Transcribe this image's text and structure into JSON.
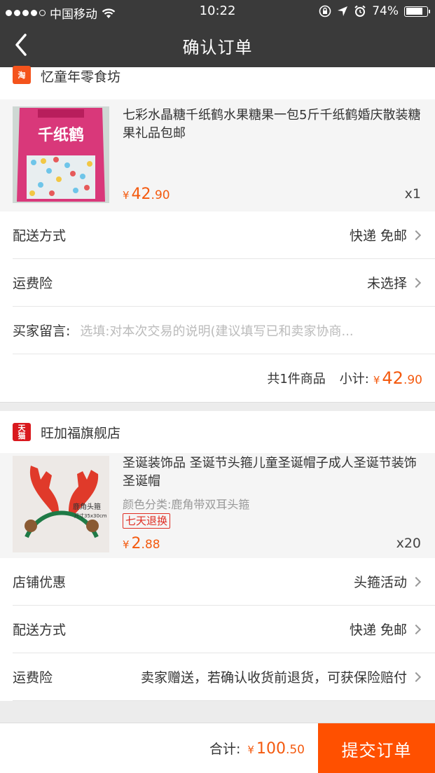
{
  "status_bar": {
    "carrier": "中国移动",
    "time": "10:22",
    "battery": "74%"
  },
  "nav": {
    "title": "确认订单"
  },
  "shops": [
    {
      "name": "忆童年零食坊",
      "logo_text": "淘",
      "product": {
        "title": "七彩水晶糖千纸鹤水果糖果一包5斤千纸鹤婚庆散装糖果礼品包邮",
        "image_text": "千纸鹤",
        "price_int": "42",
        "price_dec": ".90",
        "qty": "x1"
      },
      "delivery_label": "配送方式",
      "delivery_value": "快递 免邮",
      "insurance_label": "运费险",
      "insurance_value": "未选择",
      "message_label": "买家留言:",
      "message_placeholder": "选填:对本次交易的说明(建议填写已和卖家协商...",
      "count_text": "共1件商品",
      "subtotal_label": "小计:",
      "subtotal_int": "42",
      "subtotal_dec": ".90"
    },
    {
      "name": "旺加福旗舰店",
      "logo_line1": "天",
      "logo_line2": "猫",
      "product": {
        "title": "圣诞装饰品  圣诞节头箍儿童圣诞帽子成人圣诞节装饰 圣诞帽",
        "sku": "颜色分类:鹿角带双耳头箍",
        "tag": "七天退换",
        "image_text": "鹿角头箍",
        "image_subtext": "尺寸35x30cm",
        "price_int": "2",
        "price_dec": ".88",
        "qty": "x20"
      },
      "promo_label": "店铺优惠",
      "promo_value": "头箍活动",
      "delivery_label": "配送方式",
      "delivery_value": "快递 免邮",
      "insurance_label": "运费险",
      "insurance_value": "卖家赠送，若确认收货前退货，可获保险赔付"
    }
  ],
  "currency": "¥",
  "footer": {
    "total_label": "合计:",
    "total_int": "100",
    "total_dec": ".50",
    "submit_label": "提交订单"
  },
  "colors": {
    "accent": "#ff5000",
    "price": "#f45a0f",
    "header": "#3a3a3a"
  }
}
